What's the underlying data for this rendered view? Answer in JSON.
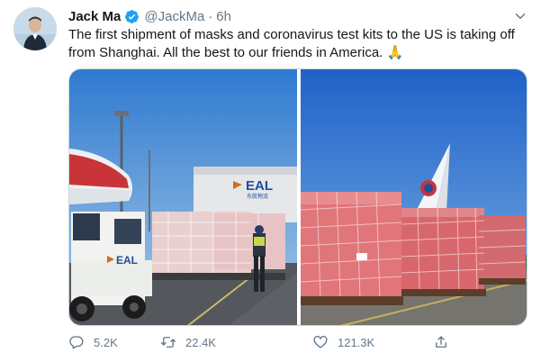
{
  "tweet": {
    "author": {
      "name": "Jack Ma",
      "handle": "@JackMa",
      "separator": "·",
      "time": "6h",
      "verified": true,
      "avatar_icon": "profile-photo"
    },
    "text": "The first shipment of masks and coronavirus test kits to the US is taking off from Shanghai. All the best to our friends in America. 🙏",
    "media": [
      {
        "kind": "photo",
        "truck_sign": "EAL",
        "building_sign_latin": "EAL",
        "building_sign_chinese": "东航物流"
      },
      {
        "kind": "photo",
        "subject": "cargo pallets wrapped in red, airplane tail"
      }
    ],
    "actions": {
      "reply": {
        "icon": "reply-icon",
        "count": "5.2K"
      },
      "retweet": {
        "icon": "retweet-icon",
        "count": "22.4K"
      },
      "like": {
        "icon": "heart-icon",
        "count": "121.3K"
      },
      "share": {
        "icon": "share-icon",
        "count": ""
      }
    }
  },
  "colors": {
    "text": "#14171a",
    "secondary": "#657786",
    "verified": "#1da1f2",
    "border": "#ccd6dd"
  }
}
